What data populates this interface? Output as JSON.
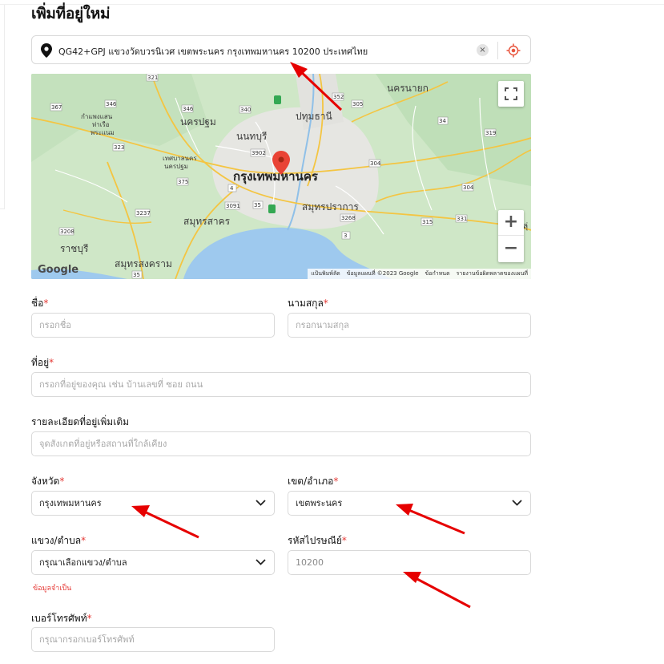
{
  "page": {
    "title": "เพิ่มที่อยู่ใหม่"
  },
  "address_bar": {
    "value": "QG42+GPJ แขวงวัดบวรนิเวศ เขตพระนคร กรุงเทพมหานคร 10200 ประเทศไทย",
    "clear_icon": "×",
    "icons": [
      "map-pin-icon",
      "close-icon",
      "locate-icon"
    ]
  },
  "map": {
    "labels": {
      "nakhon_nayok": "นครนายก",
      "pathum_thani": "ปทุมธานี",
      "nakhon_pathom": "นครปฐม",
      "nonthaburi": "นนทบุรี",
      "kamphaeng_saen": "กำแพงแสน",
      "tha_ruea": "ท่าเรือ",
      "phra_nakhon_si": "พระแนม",
      "thesaban": "เทศบาลนคร",
      "nakhon_pathom_small": "นครปฐม",
      "bangkok": "กรุงเทพมหานคร",
      "samut_prakan": "สมุทรปราการ",
      "samut_sakhon": "สมุทรสาคร",
      "ratchaburi": "ราชบุรี",
      "samut_songkhram": "สมุทรสงคราม",
      "lopburi_short": "ลุ่"
    },
    "road_numbers": [
      "321",
      "367",
      "346",
      "346",
      "340",
      "352",
      "305",
      "323",
      "3902",
      "375",
      "4",
      "3091",
      "35",
      "304",
      "3237",
      "3268",
      "315",
      "3208",
      "3",
      "34",
      "319",
      "304",
      "331",
      "35"
    ],
    "google": "Google",
    "attribution": [
      "แป้นพิมพ์ลัด",
      "ข้อมูลแผนที่ ©2023 Google",
      "ข้อกำหนด",
      "รายงานข้อผิดพลาดของแผนที่"
    ],
    "zoom_in": "+",
    "zoom_out": "−"
  },
  "form": {
    "first_name": {
      "label": "ชื่อ",
      "required": "*",
      "placeholder": "กรอกชื่อ"
    },
    "last_name": {
      "label": "นามสกุล",
      "required": "*",
      "placeholder": "กรอกนามสกุล"
    },
    "address": {
      "label": "ที่อยู่",
      "required": "*",
      "placeholder": "กรอกที่อยู่ของคุณ เช่น บ้านเลขที่ ซอย ถนน"
    },
    "address_detail": {
      "label": "รายละเอียดที่อยู่เพิ่มเติม",
      "placeholder": "จุดสังเกตที่อยู่หรือสถานที่ใกล้เคียง"
    },
    "province": {
      "label": "จังหวัด",
      "required": "*",
      "value": "กรุงเทพมหานคร"
    },
    "district": {
      "label": "เขต/อำเภอ",
      "required": "*",
      "value": "เขตพระนคร"
    },
    "subdistrict": {
      "label": "แขวง/ตำบล",
      "required": "*",
      "value": "กรุณาเลือกแขวง/ตำบล",
      "error": "ข้อมูลจำเป็น"
    },
    "postal_code": {
      "label": "รหัสไปรษณีย์",
      "required": "*",
      "value": "10200"
    },
    "phone": {
      "label": "เบอร์โทรศัพท์",
      "required": "*",
      "placeholder": "กรุณากรอกเบอร์โทรศัพท์"
    }
  },
  "colors": {
    "required": "#e53935",
    "annotation_arrow": "#e60000",
    "marker": "#e94335",
    "sea": "#9ec9ee",
    "land": "#cfe7c7",
    "urban": "#e8e8e8"
  }
}
